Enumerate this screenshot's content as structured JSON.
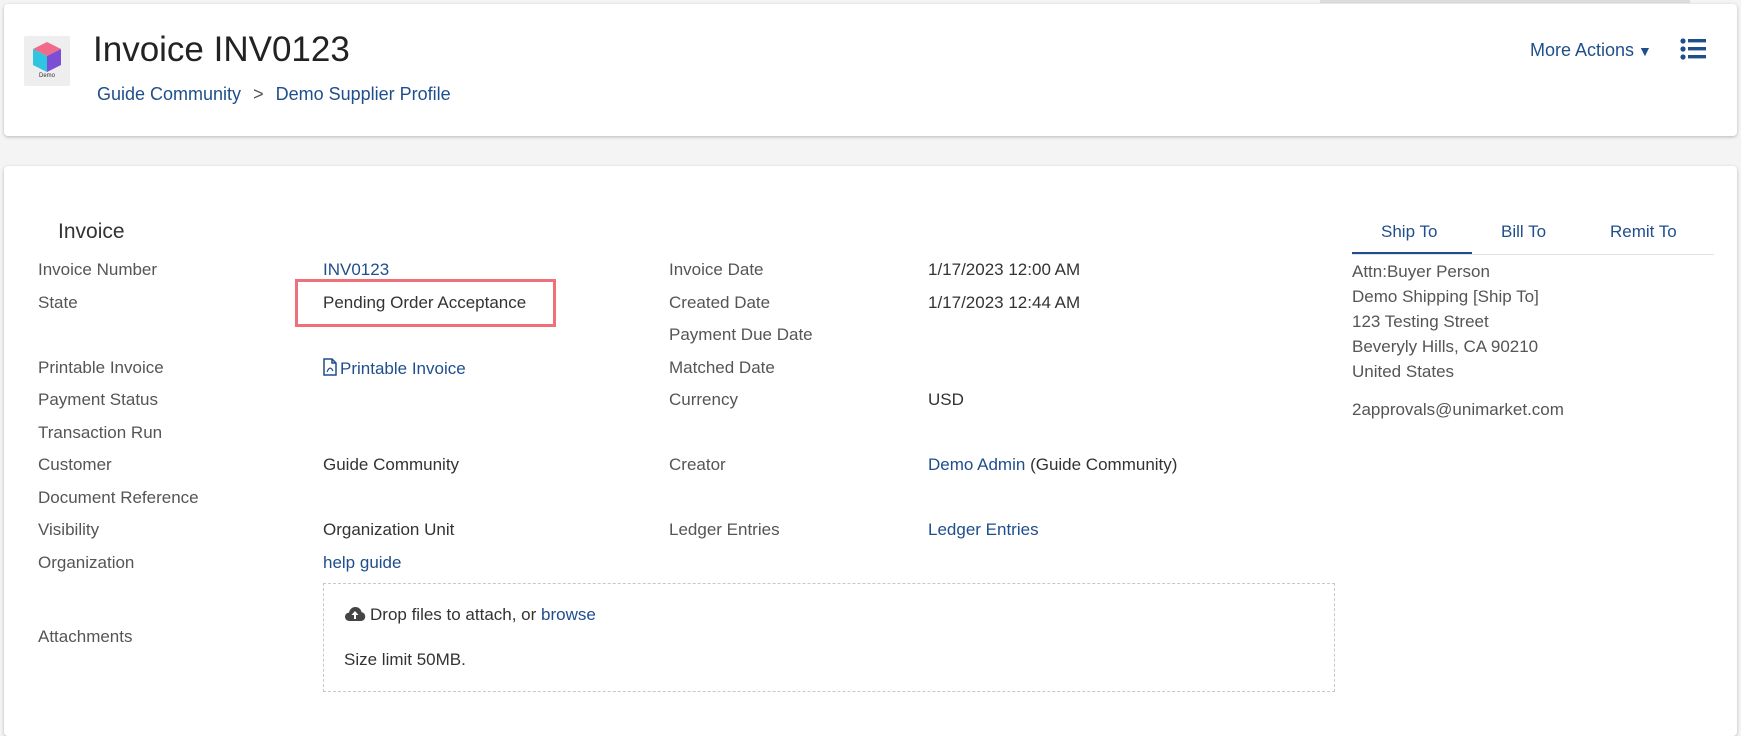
{
  "header": {
    "logo_text": "Demo",
    "title": "Invoice INV0123",
    "breadcrumb": [
      "Guide Community",
      "Demo Supplier Profile"
    ],
    "breadcrumb_sep": ">",
    "more_actions": "More Actions"
  },
  "section": {
    "title": "Invoice"
  },
  "fields_left": {
    "invoice_number": {
      "label": "Invoice Number",
      "value": "INV0123"
    },
    "state": {
      "label": "State",
      "value": "Pending Order Acceptance"
    },
    "printable_invoice": {
      "label": "Printable Invoice",
      "value": "Printable Invoice"
    },
    "payment_status": {
      "label": "Payment Status"
    },
    "transaction_run": {
      "label": "Transaction Run"
    },
    "customer": {
      "label": "Customer",
      "value": "Guide Community"
    },
    "document_reference": {
      "label": "Document Reference"
    },
    "visibility": {
      "label": "Visibility",
      "value": "Organization Unit"
    },
    "organization": {
      "label": "Organization",
      "value": "help guide"
    },
    "attachments": {
      "label": "Attachments"
    }
  },
  "fields_right": {
    "invoice_date": {
      "label": "Invoice Date",
      "value": "1/17/2023 12:00 AM"
    },
    "created_date": {
      "label": "Created Date",
      "value": "1/17/2023 12:44 AM"
    },
    "payment_due_date": {
      "label": "Payment Due Date"
    },
    "matched_date": {
      "label": "Matched Date"
    },
    "currency": {
      "label": "Currency",
      "value": "USD"
    },
    "creator": {
      "label": "Creator",
      "value_link": "Demo Admin",
      "value_suffix": "(Guide Community)"
    },
    "ledger_entries": {
      "label": "Ledger Entries",
      "value": "Ledger Entries"
    }
  },
  "address_tabs": [
    "Ship To",
    "Bill To",
    "Remit To"
  ],
  "address": {
    "lines": [
      "Attn:Buyer Person",
      "Demo Shipping [Ship To]",
      "123 Testing Street",
      "Beveryly Hills, CA 90210",
      "United States"
    ],
    "email": "2approvals@unimarket.com"
  },
  "dropzone": {
    "text": "Drop files to attach, or",
    "browse": "browse",
    "size_limit": "Size limit 50MB."
  },
  "colors": {
    "link": "#1f4e8c",
    "highlight": "#f0707a"
  },
  "icons": [
    "demo-logo-icon",
    "caret-down-icon",
    "list-menu-icon",
    "pdf-file-icon",
    "cloud-upload-icon"
  ]
}
